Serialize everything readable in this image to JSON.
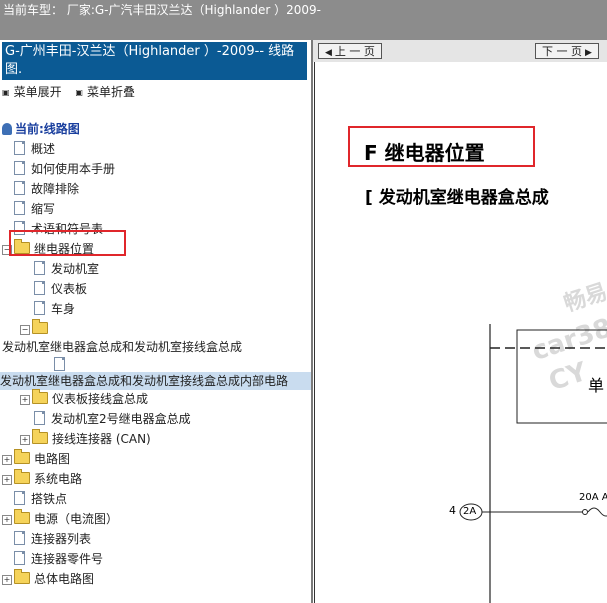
{
  "window": {
    "title": "当前车型： 厂家:G-广汽丰田汉兰达（Highlander ）2009-"
  },
  "left_panel": {
    "header": "G-广州丰田-汉兰达（Highlander ）-2009-- 线路图.",
    "expand_all": "菜单展开",
    "collapse_all": "菜单折叠",
    "root_label": "当前:线路图",
    "tree": {
      "overview": "概述",
      "how_to_use": "如何使用本手册",
      "troubleshooting": "故障排除",
      "abbreviations": "缩写",
      "terms_symbols": "术语和符号表",
      "relay_location": "继电器位置",
      "engine_room": "发动机室",
      "instrument_panel": "仪表板",
      "body": "车身",
      "engine_relay_box_long": "发动机室继电器盒总成和发动机室接线盒总成",
      "engine_relay_box_internal": "发动机室继电器盒总成和发动机室接线盒总成内部电路",
      "panel_junction_box": "仪表板接线盒总成",
      "engine_relay_box2": "发动机室2号继电器盒总成",
      "connector_can": "接线连接器 (CAN)",
      "circuit_diagrams": "电路图",
      "system_circuits": "系统电路",
      "ground_points": "搭铁点",
      "power_flow": "电源（电流图）",
      "connector_list": "连接器列表",
      "connector_parts": "连接器零件号",
      "overall_wiring": "总体电路图"
    }
  },
  "right_panel": {
    "prev_page": "上 一 页",
    "next_page": "下 一 页",
    "page_title": "F  继电器位置",
    "section_heading": "[ 发动机室继电器盒总成",
    "diagram": {
      "label_single": "单",
      "connector_num": "4",
      "connector_pin": "2A",
      "fuse_label": "20A A"
    },
    "watermarks": [
      "畅易",
      "car38",
      "CY"
    ]
  }
}
